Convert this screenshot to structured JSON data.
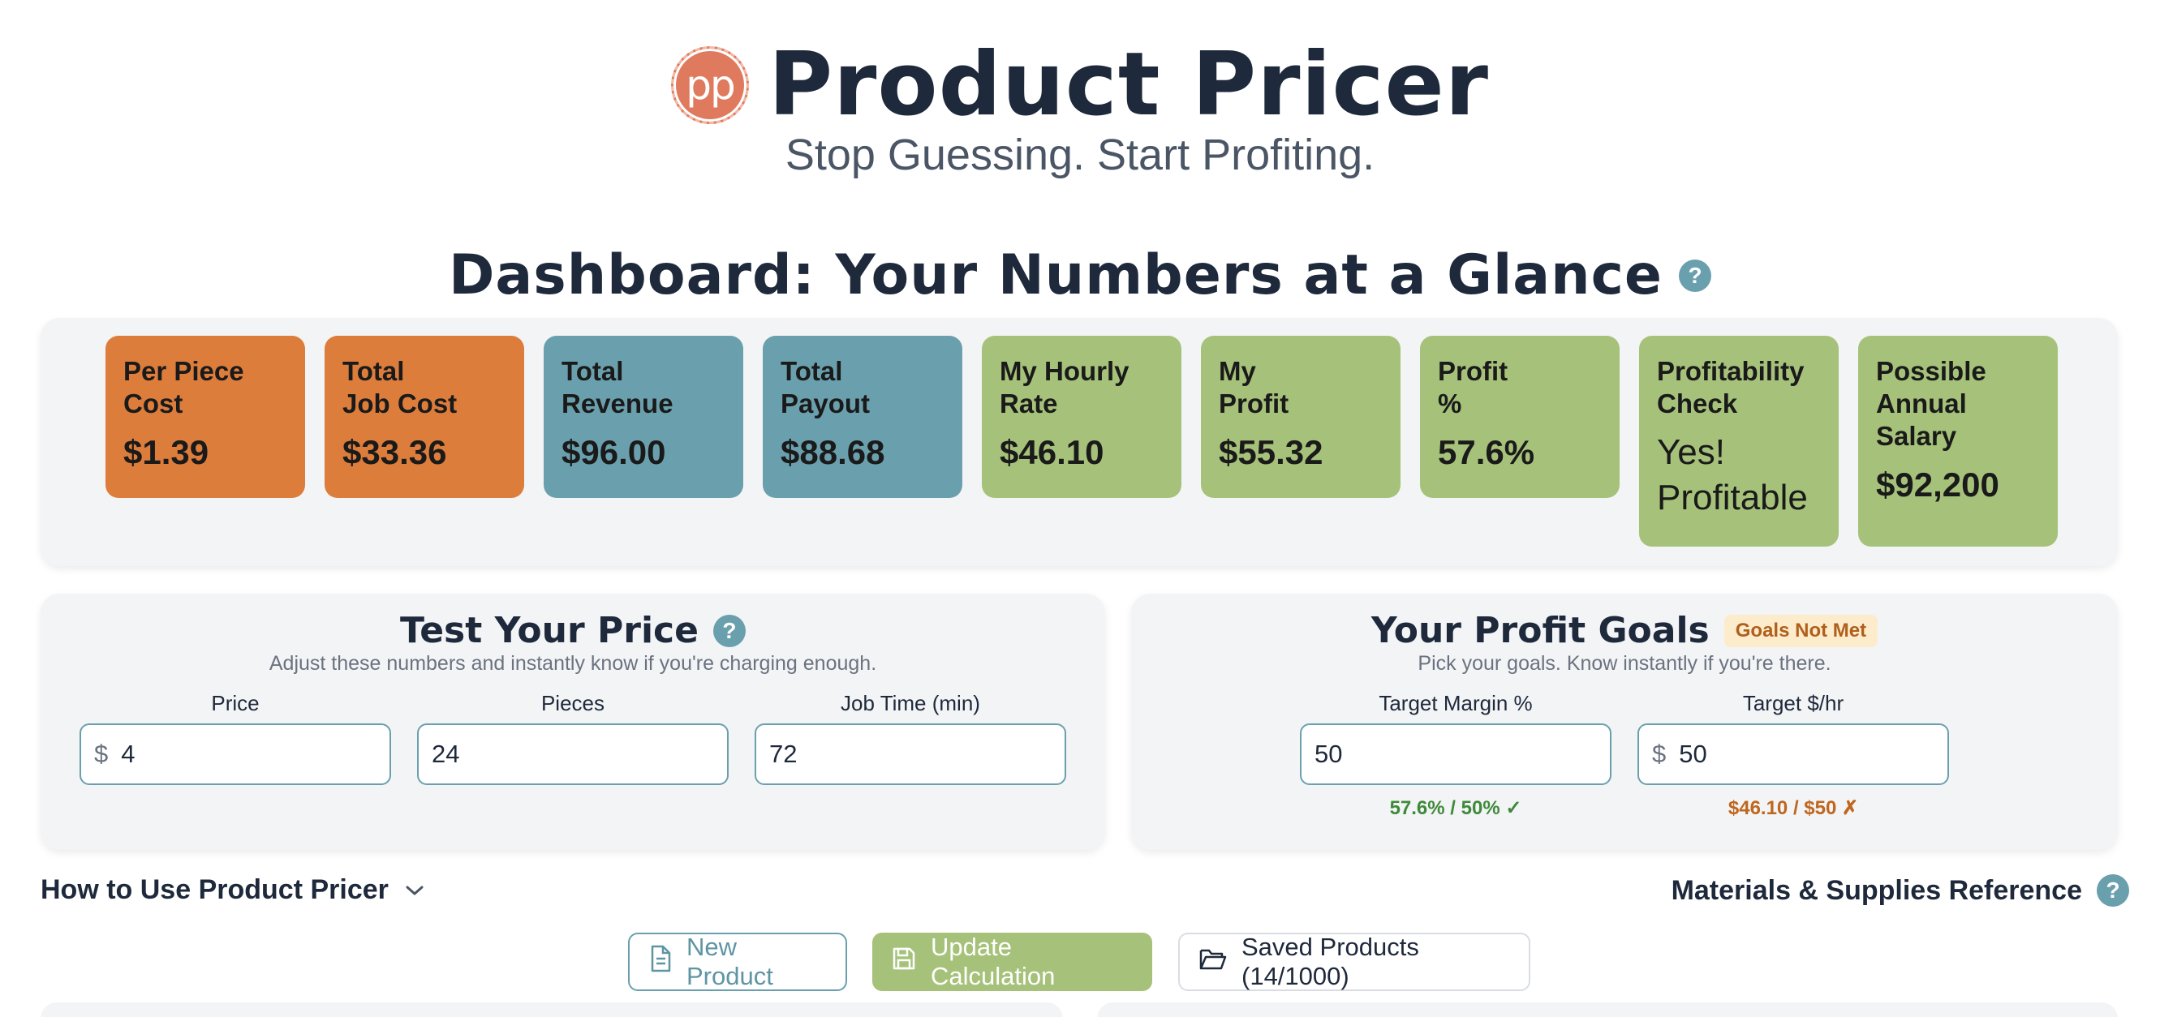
{
  "app": {
    "logo_text": "pp",
    "title": "Product Pricer",
    "tagline": "Stop Guessing. Start Profiting."
  },
  "dashboard": {
    "heading": "Dashboard: Your Numbers at a Glance",
    "help_icon": "?",
    "cards": [
      {
        "label": "Per Piece\nCost",
        "value": "$1.39",
        "color": "#dd7d3c"
      },
      {
        "label": "Total\nJob Cost",
        "value": "$33.36",
        "color": "#dd7d3c"
      },
      {
        "label": "Total\nRevenue",
        "value": "$96.00",
        "color": "#6aa0ad"
      },
      {
        "label": "Total\nPayout",
        "value": "$88.68",
        "color": "#6aa0ad"
      },
      {
        "label": "My Hourly\nRate",
        "value": "$46.10",
        "color": "#a6c27a"
      },
      {
        "label": "My\nProfit",
        "value": "$55.32",
        "color": "#a6c27a"
      },
      {
        "label": "Profit\n%",
        "value": "57.6%",
        "color": "#a6c27a"
      },
      {
        "label": "Profitability\nCheck",
        "value": "Yes!\nProfitable",
        "color": "#a6c27a"
      },
      {
        "label": "Possible\nAnnual\nSalary",
        "value": "$92,200",
        "color": "#a6c27a"
      }
    ]
  },
  "test_price": {
    "title": "Test Your Price",
    "subtitle": "Adjust these numbers and instantly know if you're charging enough.",
    "fields": [
      {
        "label": "Price",
        "prefix": "$",
        "value": "4"
      },
      {
        "label": "Pieces",
        "value": "24"
      },
      {
        "label": "Job Time (min)",
        "value": "72"
      }
    ]
  },
  "goals": {
    "title": "Your Profit Goals",
    "badge": "Goals Not Met",
    "subtitle": "Pick your goals. Know instantly if you're there.",
    "fields": [
      {
        "label": "Target Margin %",
        "value": "50",
        "status": "57.6% / 50% ✓"
      },
      {
        "label": "Target $/hr",
        "prefix": "$",
        "value": "50",
        "status": "$46.10 / $50 ✗"
      }
    ]
  },
  "links": {
    "how_to": "How to Use Product Pricer",
    "materials": "Materials & Supplies Reference"
  },
  "buttons": {
    "new_product": "New Product",
    "update": "Update Calculation",
    "saved": "Saved Products (14/1000)"
  }
}
